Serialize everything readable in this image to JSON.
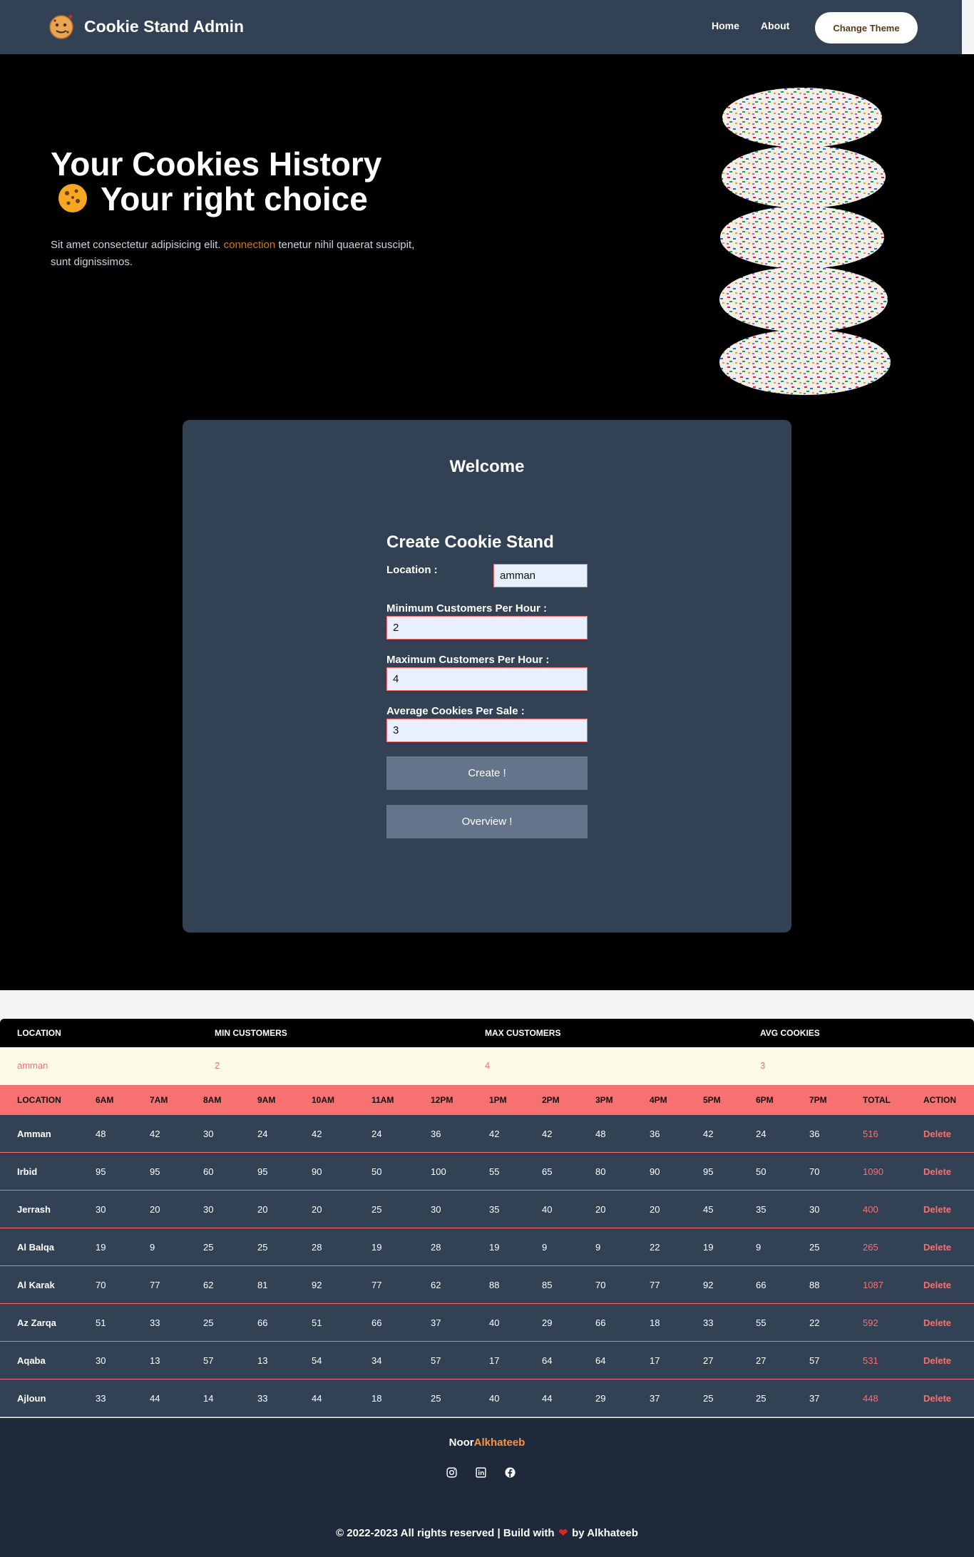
{
  "nav": {
    "brand": "Cookie Stand Admin",
    "links": [
      "Home",
      "About"
    ],
    "theme_button": "Change Theme"
  },
  "hero": {
    "title_line1": "Your Cookies History",
    "title_line2": "Your right choice",
    "text_before": "Sit amet consectetur adipisicing elit. ",
    "text_highlight": "connection",
    "text_after": " tenetur nihil quaerat suscipit, sunt dignissimos."
  },
  "card": {
    "welcome": "Welcome",
    "form_title": "Create Cookie Stand",
    "location_label": "Location :",
    "location_value": "amman",
    "min_label": "Minimum Customers Per Hour :",
    "min_value": "2",
    "max_label": "Maximum Customers Per Hour :",
    "max_value": "4",
    "avg_label": "Average Cookies Per Sale :",
    "avg_value": "3",
    "create_button": "Create !",
    "overview_button": "Overview !"
  },
  "summary_table": {
    "headers": [
      "LOCATION",
      "MIN CUSTOMERS",
      "MAX CUSTOMERS",
      "AVG COOKIES"
    ],
    "row": [
      "amman",
      "2",
      "4",
      "3"
    ]
  },
  "sales_table": {
    "headers": [
      "LOCATION",
      "6AM",
      "7AM",
      "8AM",
      "9AM",
      "10AM",
      "11AM",
      "12PM",
      "1PM",
      "2PM",
      "3PM",
      "4PM",
      "5PM",
      "6PM",
      "7PM",
      "TOTAL",
      "ACTION"
    ],
    "rows": [
      {
        "location": "Amman",
        "hours": [
          "48",
          "42",
          "30",
          "24",
          "42",
          "24",
          "36",
          "42",
          "42",
          "48",
          "36",
          "42",
          "24",
          "36"
        ],
        "total": "516",
        "action": "Delete"
      },
      {
        "location": "Irbid",
        "hours": [
          "95",
          "95",
          "60",
          "95",
          "90",
          "50",
          "100",
          "55",
          "65",
          "80",
          "90",
          "95",
          "50",
          "70"
        ],
        "total": "1090",
        "action": "Delete"
      },
      {
        "location": "Jerrash",
        "hours": [
          "30",
          "20",
          "30",
          "20",
          "20",
          "25",
          "30",
          "35",
          "40",
          "20",
          "20",
          "45",
          "35",
          "30"
        ],
        "total": "400",
        "action": "Delete"
      },
      {
        "location": "Al Balqa",
        "hours": [
          "19",
          "9",
          "25",
          "25",
          "28",
          "19",
          "28",
          "19",
          "9",
          "9",
          "22",
          "19",
          "9",
          "25"
        ],
        "total": "265",
        "action": "Delete"
      },
      {
        "location": "Al Karak",
        "hours": [
          "70",
          "77",
          "62",
          "81",
          "92",
          "77",
          "62",
          "88",
          "85",
          "70",
          "77",
          "92",
          "66",
          "88"
        ],
        "total": "1087",
        "action": "Delete"
      },
      {
        "location": "Az Zarqa",
        "hours": [
          "51",
          "33",
          "25",
          "66",
          "51",
          "66",
          "37",
          "40",
          "29",
          "66",
          "18",
          "33",
          "55",
          "22"
        ],
        "total": "592",
        "action": "Delete"
      },
      {
        "location": "Aqaba",
        "hours": [
          "30",
          "13",
          "57",
          "13",
          "54",
          "34",
          "57",
          "17",
          "64",
          "64",
          "17",
          "27",
          "27",
          "57"
        ],
        "total": "531",
        "action": "Delete"
      },
      {
        "location": "Ajloun",
        "hours": [
          "33",
          "44",
          "14",
          "33",
          "44",
          "18",
          "25",
          "40",
          "44",
          "29",
          "37",
          "25",
          "25",
          "37"
        ],
        "total": "448",
        "action": "Delete"
      }
    ]
  },
  "footer": {
    "name_first": "Noor",
    "name_last": "Alkhateeb",
    "icons": [
      "instagram-icon",
      "linkedin-icon",
      "facebook-icon"
    ],
    "copy_before": "© 2022-2023 All rights reserved | Build with",
    "copy_after": "by Alkhateeb"
  }
}
